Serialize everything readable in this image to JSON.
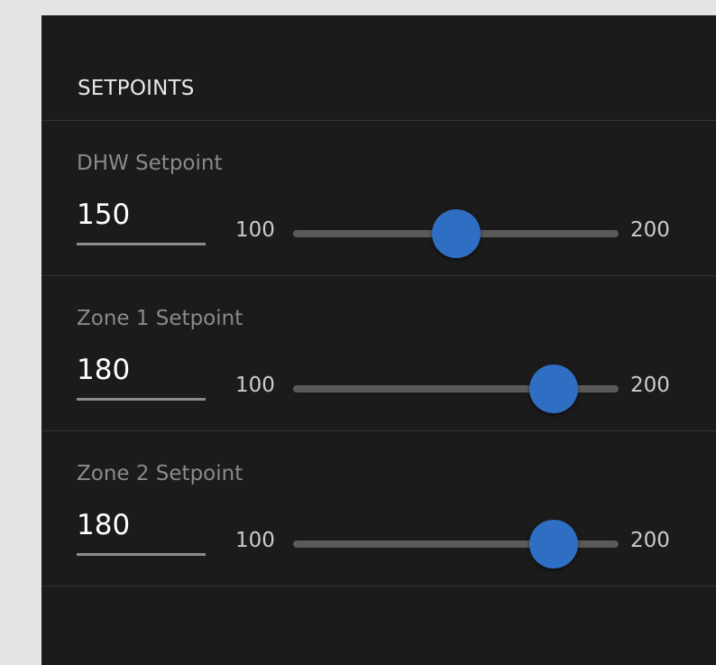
{
  "panel": {
    "title": "SETPOINTS"
  },
  "colors": {
    "accent": "#2e6fc4",
    "panel_background": "#1b1b1b",
    "page_background": "#e4e4e4"
  },
  "setpoints": [
    {
      "label": "DHW Setpoint",
      "value": "150",
      "min": "100",
      "max": "200",
      "slider_value": 150
    },
    {
      "label": "Zone 1 Setpoint",
      "value": "180",
      "min": "100",
      "max": "200",
      "slider_value": 180
    },
    {
      "label": "Zone 2 Setpoint",
      "value": "180",
      "min": "100",
      "max": "200",
      "slider_value": 180
    }
  ]
}
